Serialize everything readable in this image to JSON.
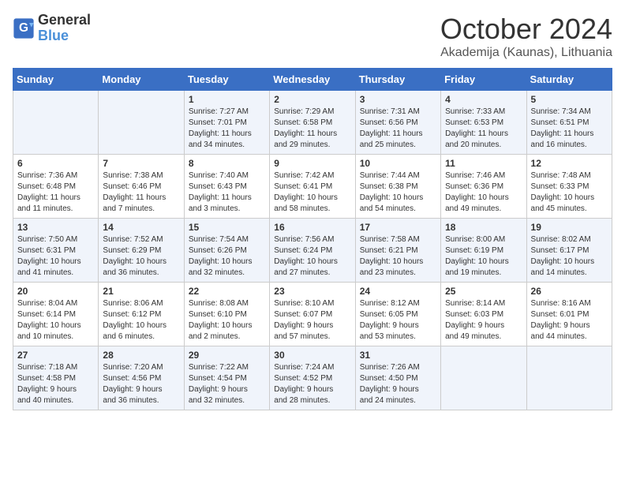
{
  "header": {
    "logo_line1": "General",
    "logo_line2": "Blue",
    "month": "October 2024",
    "location": "Akademija (Kaunas), Lithuania"
  },
  "days_of_week": [
    "Sunday",
    "Monday",
    "Tuesday",
    "Wednesday",
    "Thursday",
    "Friday",
    "Saturday"
  ],
  "weeks": [
    [
      {
        "day": "",
        "info": ""
      },
      {
        "day": "",
        "info": ""
      },
      {
        "day": "1",
        "info": "Sunrise: 7:27 AM\nSunset: 7:01 PM\nDaylight: 11 hours\nand 34 minutes."
      },
      {
        "day": "2",
        "info": "Sunrise: 7:29 AM\nSunset: 6:58 PM\nDaylight: 11 hours\nand 29 minutes."
      },
      {
        "day": "3",
        "info": "Sunrise: 7:31 AM\nSunset: 6:56 PM\nDaylight: 11 hours\nand 25 minutes."
      },
      {
        "day": "4",
        "info": "Sunrise: 7:33 AM\nSunset: 6:53 PM\nDaylight: 11 hours\nand 20 minutes."
      },
      {
        "day": "5",
        "info": "Sunrise: 7:34 AM\nSunset: 6:51 PM\nDaylight: 11 hours\nand 16 minutes."
      }
    ],
    [
      {
        "day": "6",
        "info": "Sunrise: 7:36 AM\nSunset: 6:48 PM\nDaylight: 11 hours\nand 11 minutes."
      },
      {
        "day": "7",
        "info": "Sunrise: 7:38 AM\nSunset: 6:46 PM\nDaylight: 11 hours\nand 7 minutes."
      },
      {
        "day": "8",
        "info": "Sunrise: 7:40 AM\nSunset: 6:43 PM\nDaylight: 11 hours\nand 3 minutes."
      },
      {
        "day": "9",
        "info": "Sunrise: 7:42 AM\nSunset: 6:41 PM\nDaylight: 10 hours\nand 58 minutes."
      },
      {
        "day": "10",
        "info": "Sunrise: 7:44 AM\nSunset: 6:38 PM\nDaylight: 10 hours\nand 54 minutes."
      },
      {
        "day": "11",
        "info": "Sunrise: 7:46 AM\nSunset: 6:36 PM\nDaylight: 10 hours\nand 49 minutes."
      },
      {
        "day": "12",
        "info": "Sunrise: 7:48 AM\nSunset: 6:33 PM\nDaylight: 10 hours\nand 45 minutes."
      }
    ],
    [
      {
        "day": "13",
        "info": "Sunrise: 7:50 AM\nSunset: 6:31 PM\nDaylight: 10 hours\nand 41 minutes."
      },
      {
        "day": "14",
        "info": "Sunrise: 7:52 AM\nSunset: 6:29 PM\nDaylight: 10 hours\nand 36 minutes."
      },
      {
        "day": "15",
        "info": "Sunrise: 7:54 AM\nSunset: 6:26 PM\nDaylight: 10 hours\nand 32 minutes."
      },
      {
        "day": "16",
        "info": "Sunrise: 7:56 AM\nSunset: 6:24 PM\nDaylight: 10 hours\nand 27 minutes."
      },
      {
        "day": "17",
        "info": "Sunrise: 7:58 AM\nSunset: 6:21 PM\nDaylight: 10 hours\nand 23 minutes."
      },
      {
        "day": "18",
        "info": "Sunrise: 8:00 AM\nSunset: 6:19 PM\nDaylight: 10 hours\nand 19 minutes."
      },
      {
        "day": "19",
        "info": "Sunrise: 8:02 AM\nSunset: 6:17 PM\nDaylight: 10 hours\nand 14 minutes."
      }
    ],
    [
      {
        "day": "20",
        "info": "Sunrise: 8:04 AM\nSunset: 6:14 PM\nDaylight: 10 hours\nand 10 minutes."
      },
      {
        "day": "21",
        "info": "Sunrise: 8:06 AM\nSunset: 6:12 PM\nDaylight: 10 hours\nand 6 minutes."
      },
      {
        "day": "22",
        "info": "Sunrise: 8:08 AM\nSunset: 6:10 PM\nDaylight: 10 hours\nand 2 minutes."
      },
      {
        "day": "23",
        "info": "Sunrise: 8:10 AM\nSunset: 6:07 PM\nDaylight: 9 hours\nand 57 minutes."
      },
      {
        "day": "24",
        "info": "Sunrise: 8:12 AM\nSunset: 6:05 PM\nDaylight: 9 hours\nand 53 minutes."
      },
      {
        "day": "25",
        "info": "Sunrise: 8:14 AM\nSunset: 6:03 PM\nDaylight: 9 hours\nand 49 minutes."
      },
      {
        "day": "26",
        "info": "Sunrise: 8:16 AM\nSunset: 6:01 PM\nDaylight: 9 hours\nand 44 minutes."
      }
    ],
    [
      {
        "day": "27",
        "info": "Sunrise: 7:18 AM\nSunset: 4:58 PM\nDaylight: 9 hours\nand 40 minutes."
      },
      {
        "day": "28",
        "info": "Sunrise: 7:20 AM\nSunset: 4:56 PM\nDaylight: 9 hours\nand 36 minutes."
      },
      {
        "day": "29",
        "info": "Sunrise: 7:22 AM\nSunset: 4:54 PM\nDaylight: 9 hours\nand 32 minutes."
      },
      {
        "day": "30",
        "info": "Sunrise: 7:24 AM\nSunset: 4:52 PM\nDaylight: 9 hours\nand 28 minutes."
      },
      {
        "day": "31",
        "info": "Sunrise: 7:26 AM\nSunset: 4:50 PM\nDaylight: 9 hours\nand 24 minutes."
      },
      {
        "day": "",
        "info": ""
      },
      {
        "day": "",
        "info": ""
      }
    ]
  ]
}
